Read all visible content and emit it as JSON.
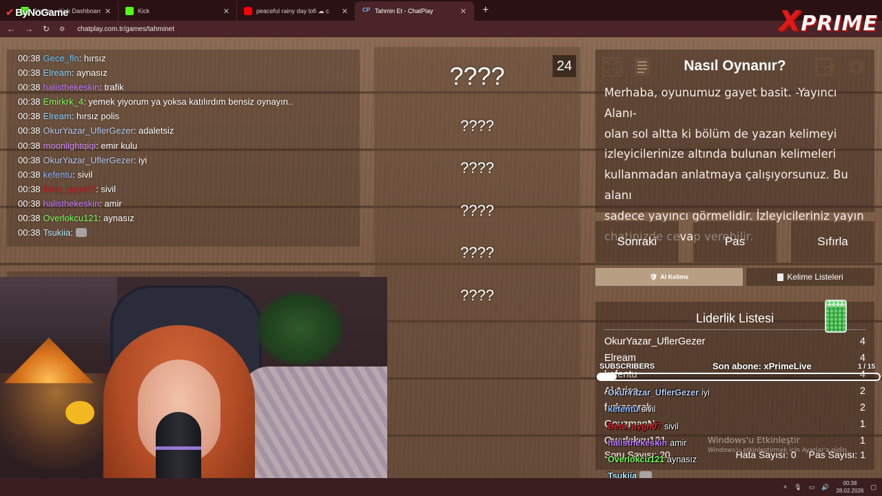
{
  "browser": {
    "tabs": [
      {
        "icon": "kick",
        "title": "Stream - Kick Dashboard",
        "active": false
      },
      {
        "icon": "kick",
        "title": "Kick",
        "active": false
      },
      {
        "icon": "youtube",
        "title": "peaceful rainy day lofi ☁ c",
        "active": false
      },
      {
        "icon": "chatplay",
        "title": "Tahmin Et - ChatPlay",
        "active": true
      }
    ],
    "url": "chatplay.com.tr/games/tahminet"
  },
  "overlay_logos": {
    "bynogame": "ByNoGame",
    "xprime": "PRIME"
  },
  "chat": {
    "lines": [
      {
        "time": "00:38",
        "user": "Gece_fln",
        "color": "#6ec8ff",
        "msg": "hırsız"
      },
      {
        "time": "00:38",
        "user": "Elream",
        "color": "#8fd3ff",
        "msg": "aynasız"
      },
      {
        "time": "00:38",
        "user": "halisthekeskin",
        "color": "#c57cff",
        "msg": "trafik"
      },
      {
        "time": "00:38",
        "user": "Emirkrk_4",
        "color": "#7cff5a",
        "msg": "yemek yiyorum ya yoksa katılırdım bensiz oynayın.."
      },
      {
        "time": "00:38",
        "user": "Elream",
        "color": "#8fd3ff",
        "msg": "hırsız polis"
      },
      {
        "time": "00:38",
        "user": "OkurYazar_UflerGezer",
        "color": "#b7cdf2",
        "msg": "adaletsiz"
      },
      {
        "time": "00:38",
        "user": "moonlightqiqi",
        "color": "#d48cff",
        "msg": "emir kulu"
      },
      {
        "time": "00:38",
        "user": "OkurYazar_UflerGezer",
        "color": "#b7cdf2",
        "msg": "iyi"
      },
      {
        "time": "00:38",
        "user": "kefentu",
        "color": "#8fb8ff",
        "msg": "sivil"
      },
      {
        "time": "00:38",
        "user": "Beto_aygn07",
        "color": "#e0252a",
        "msg": "sivil"
      },
      {
        "time": "00:38",
        "user": "halisthekeskin",
        "color": "#c57cff",
        "msg": "amir"
      },
      {
        "time": "00:38",
        "user": "Overlokcu121",
        "color": "#7cff5a",
        "msg": "aynasız"
      },
      {
        "time": "00:38",
        "user": "Tsukiia",
        "color": "#b7ecff",
        "msg": "",
        "emote": true
      }
    ]
  },
  "game": {
    "timer": "24",
    "words": [
      "????",
      "????",
      "????",
      "????",
      "????",
      "????"
    ]
  },
  "howto": {
    "title": "Nasıl Oynanır?",
    "text_lines": [
      "Merhaba, oyunumuz gayet basit. -Yayıncı Alanı-",
      "olan sol altta ki bölüm de yazan kelimeyi",
      "izleyicilerinize altında bulunan kelimeleri",
      "kullanmadan anlatmaya çalışıyorsunuz. Bu alanı",
      "sadece yayıncı görmelidir. İzleyicileriniz yayın",
      "chatinizde cevap verebilir."
    ]
  },
  "controls": {
    "next": "Sonraki",
    "pass": "Pas",
    "reset": "Sıfırla",
    "ai_word": "AI Kelime",
    "word_lists": "Kelime Listeleri"
  },
  "leaderboard": {
    "title": "Liderlik Listesi",
    "rows": [
      {
        "name": "OkurYazar_UflerGezer",
        "score": "4"
      },
      {
        "name": "Elream",
        "score": "4"
      },
      {
        "name": "kefentu",
        "score": "4"
      },
      {
        "name": "Al Arize",
        "score": "2"
      },
      {
        "name": "furkanorak",
        "score": "2"
      },
      {
        "name": "GouzmanN",
        "score": "1"
      },
      {
        "name": "Overlokcu121",
        "score": "1"
      }
    ],
    "soru_sayisi": "Soru Sayısı: 20",
    "hata_sayisi": "Hata Sayısı: 0",
    "pas_sayisi": "Pas Sayısı: 1"
  },
  "subscriber_goal": {
    "label": "SUBSCRIBERS",
    "last_sub": "Son abone: xPrimeLive",
    "count": "1 / 15",
    "progress": 0.067
  },
  "stream_chat_overlay": [
    {
      "user": "OkurYazar_UflerGezer",
      "color": "#b7cdf2",
      "msg": "iyi"
    },
    {
      "user": "kefentu",
      "color": "#8fb8ff",
      "msg": "sivil"
    },
    {
      "user": "Beto_aygn07",
      "color": "#e0252a",
      "msg": "sivil"
    },
    {
      "user": "halisthekeskin",
      "color": "#c57cff",
      "msg": "amir"
    },
    {
      "user": "Overlokcu121",
      "color": "#7cff5a",
      "msg": "aynasız"
    },
    {
      "user": "Tsukiia",
      "color": "#b7ecff",
      "msg": "",
      "emote": true
    }
  ],
  "windows": {
    "activate_title": "Windows'u Etkinleştir",
    "activate_sub": "Windows'u etkinleştirmek için Ayarlar'a gidin.",
    "time": "00:38",
    "date": "28.02.2026"
  }
}
